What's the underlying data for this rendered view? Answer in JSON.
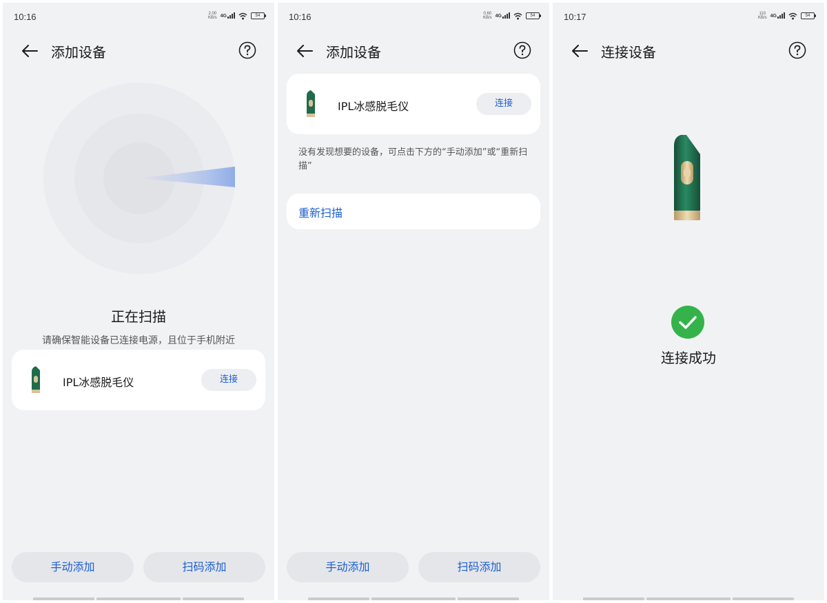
{
  "screens": [
    {
      "status": {
        "time": "10:16",
        "speed_value": "2.00",
        "speed_unit": "KB/s",
        "network": "4G",
        "battery": "54"
      },
      "title": "添加设备",
      "scan": {
        "title": "正在扫描",
        "hint": "请确保智能设备已连接电源，且位于手机附近"
      },
      "device": {
        "name": "IPL冰感脱毛仪",
        "connect_label": "连接"
      },
      "buttons": {
        "manual": "手动添加",
        "scan_code": "扫码添加"
      }
    },
    {
      "status": {
        "time": "10:16",
        "speed_value": "0.60",
        "speed_unit": "KB/s",
        "network": "4G",
        "battery": "54"
      },
      "title": "添加设备",
      "device": {
        "name": "IPL冰感脱毛仪",
        "connect_label": "连接"
      },
      "not_found_hint": "没有发现想要的设备，可点击下方的“手动添加”或“重新扫描”",
      "rescan_label": "重新扫描",
      "buttons": {
        "manual": "手动添加",
        "scan_code": "扫码添加"
      }
    },
    {
      "status": {
        "time": "10:17",
        "speed_value": "110",
        "speed_unit": "KB/s",
        "network": "4G",
        "battery": "54"
      },
      "title": "连接设备",
      "success_text": "连接成功"
    }
  ],
  "colors": {
    "accent": "#1d5fd1",
    "success": "#34b34a",
    "background": "#f1f2f4",
    "device_green": "#1f6b4a",
    "device_gold": "#d9c29a"
  },
  "icons": [
    "arrow-left-icon",
    "help-circle-icon",
    "signal-icon",
    "wifi-icon",
    "battery-icon",
    "check-circle-icon"
  ]
}
